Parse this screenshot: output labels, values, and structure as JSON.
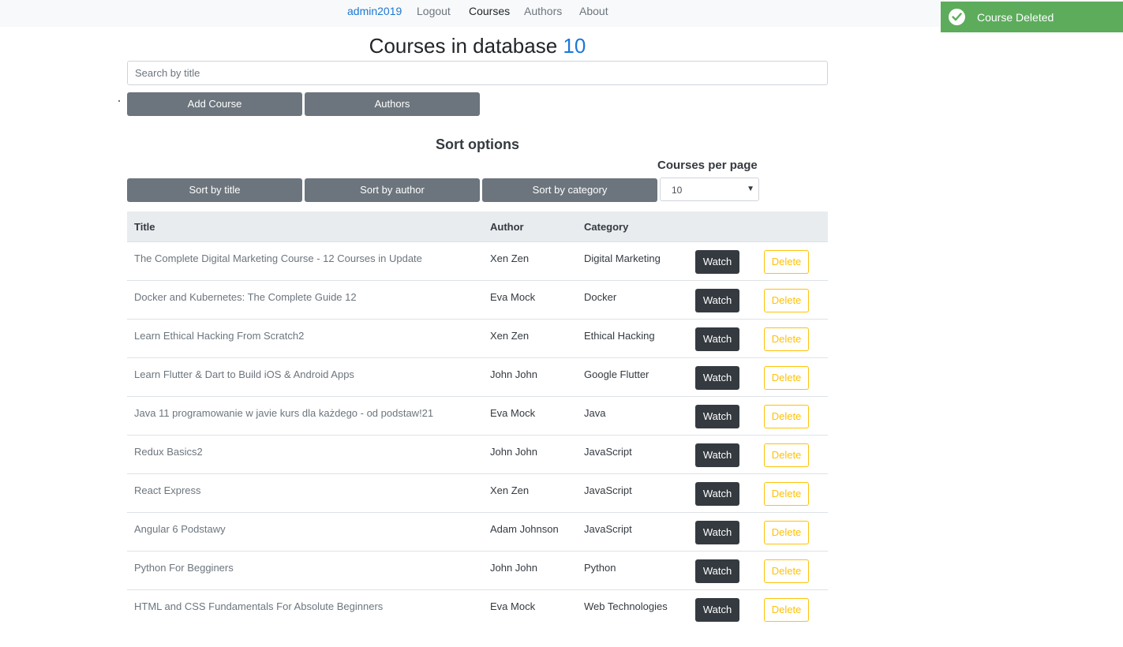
{
  "nav": {
    "user": "admin2019",
    "logout": "Logout",
    "courses": "Courses",
    "authors": "Authors",
    "about": "About"
  },
  "toast": {
    "message": "Course Deleted",
    "icon": "check-circle-icon",
    "color": "#5cac5c"
  },
  "header": {
    "title": "Courses in database",
    "count": "10"
  },
  "search": {
    "placeholder": "Search by title",
    "value": ""
  },
  "actions": {
    "add_course": "Add Course",
    "authors": "Authors"
  },
  "sort": {
    "heading": "Sort options",
    "by_title": "Sort by title",
    "by_author": "Sort by author",
    "by_category": "Sort by category",
    "per_page_label": "Courses per page",
    "per_page_value": "10"
  },
  "table": {
    "columns": [
      "Title",
      "Author",
      "Category"
    ],
    "watch_label": "Watch",
    "delete_label": "Delete",
    "rows": [
      {
        "title": "The Complete Digital Marketing Course - 12 Courses in Update",
        "author": "Xen Zen",
        "category": "Digital Marketing"
      },
      {
        "title": "Docker and Kubernetes: The Complete Guide 12",
        "author": "Eva Mock",
        "category": "Docker"
      },
      {
        "title": "Learn Ethical Hacking From Scratch2",
        "author": "Xen Zen",
        "category": "Ethical Hacking"
      },
      {
        "title": "Learn Flutter & Dart to Build iOS & Android Apps",
        "author": "John John",
        "category": "Google Flutter"
      },
      {
        "title": "Java 11 programowanie w javie kurs dla każdego - od podstaw!21",
        "author": "Eva Mock",
        "category": "Java"
      },
      {
        "title": "Redux Basics2",
        "author": "John John",
        "category": "JavaScript"
      },
      {
        "title": "React Express",
        "author": "Xen Zen",
        "category": "JavaScript"
      },
      {
        "title": "Angular 6 Podstawy",
        "author": "Adam Johnson",
        "category": "JavaScript"
      },
      {
        "title": "Python For Begginers",
        "author": "John John",
        "category": "Python"
      },
      {
        "title": "HTML and CSS Fundamentals For Absolute Beginners",
        "author": "Eva Mock",
        "category": "Web Technologies"
      }
    ]
  }
}
